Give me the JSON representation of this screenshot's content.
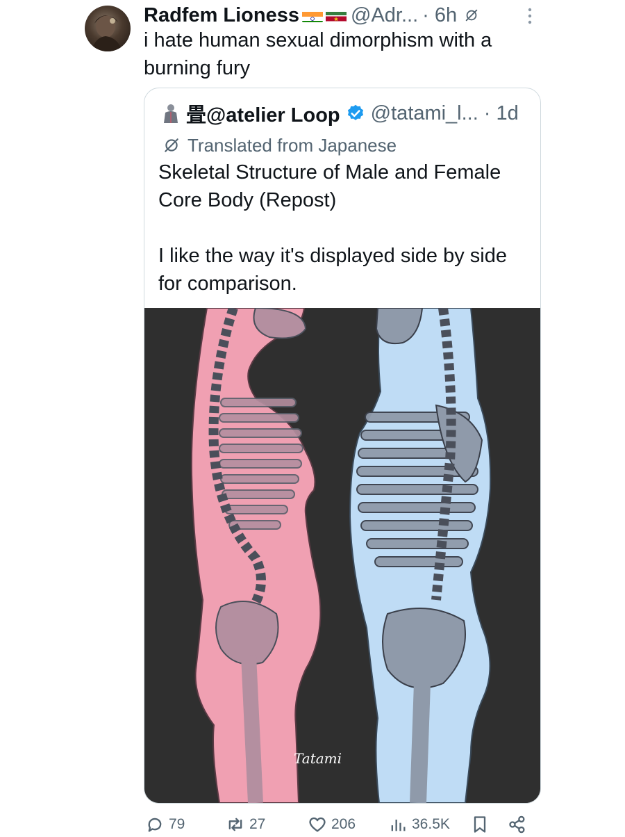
{
  "tweet": {
    "display_name": "Radfem Lioness",
    "handle": "@Adr...",
    "time": "· 6h",
    "text": "i hate human sexual dimorphism with a burning fury",
    "flags": [
      "india-flag",
      "suriname-flag"
    ]
  },
  "quote": {
    "display_name": "畳@atelier Loop",
    "handle": "@tatami_l...",
    "time": "· 1d",
    "translated_label": "Translated from Japanese",
    "text": "Skeletal Structure of Male and Female Core Body (Repost)\n\nI like the way it's displayed side by side for comparison.",
    "image_signature": "Tatami"
  },
  "actions": {
    "replies": "79",
    "reposts": "27",
    "likes": "206",
    "views": "36.5K"
  },
  "colors": {
    "text": "#0f1419",
    "secondary": "#536471",
    "border": "#cfd9de",
    "verified": "#1d9bf0",
    "artwork_bg": "#2f2f2f",
    "female_body": "#f0a0b2",
    "male_body": "#bfdcf5"
  }
}
